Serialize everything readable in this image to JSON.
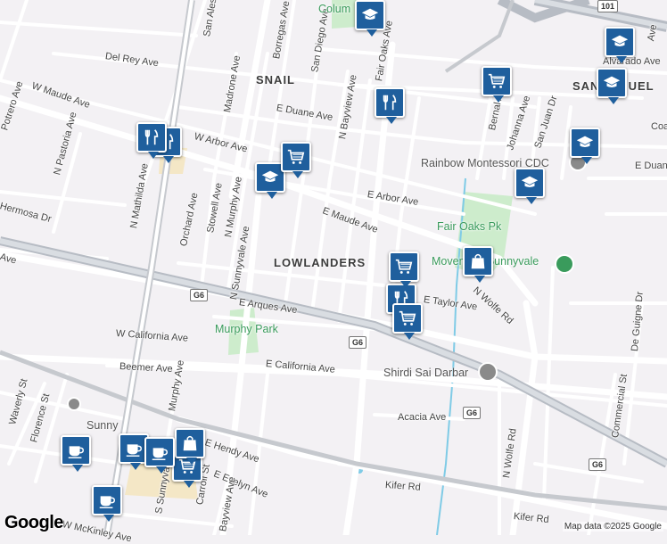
{
  "map": {
    "neighborhoods": [
      "SNAIL",
      "LOWLANDERS",
      "SAN MIGUEL"
    ],
    "streets": [
      "Del Rey Ave",
      "W Maude Ave",
      "Potrero Ave",
      "N Pastoria Ave",
      "N Mathilda Ave",
      "Hermosa Dr",
      "Orchard Ave",
      "Stowell Ave",
      "N Murphy Ave",
      "N Sunnyvale Ave",
      "Madrone Ave",
      "San Aleso Ave",
      "Borregas Ave",
      "W Arbor Ave",
      "E Duane Ave",
      "E Arbor Ave",
      "E Maude Ave",
      "San Diego Ave",
      "N Bayview Ave",
      "Fair Oaks Ave",
      "Bernal Ave",
      "Johanna Ave",
      "San Juan Dr",
      "Alvarado Ave",
      "E Duane Ave",
      "E Arques Ave",
      "E Taylor Ave",
      "N Wolfe Rd",
      "De Guigne Dr",
      "Commercial St",
      "W California Ave",
      "E California Ave",
      "Beemer Ave",
      "Murphy Ave",
      "E Hendy Ave",
      "E Evelyn Ave",
      "Acacia Ave",
      "Kifer Rd",
      "Kifer Rd",
      "Waverly St",
      "Florence St",
      "W McKinley Ave",
      "Carroll St",
      "S Sunnyvale Ave",
      "Bayview Ave",
      "N Wolfe Rd",
      "Ave",
      "Coa",
      "Ave"
    ],
    "shields": [
      "G6",
      "G6",
      "G6",
      "G6",
      "101"
    ],
    "places": [
      {
        "name": "Colum",
        "color": "#3a9b5c"
      },
      {
        "name": "Rainbow Montessori CDC",
        "color": "#555555"
      },
      {
        "name": "Fair Oaks Pk",
        "color": "#3a9b5c"
      },
      {
        "name": "Movement Sunnyvale",
        "color": "#3a9b5c"
      },
      {
        "name": "Murphy Park",
        "color": "#3a9b5c"
      },
      {
        "name": "Shirdi Sai Darbar",
        "color": "#555555"
      },
      {
        "name": "Sunny",
        "color": "#555555"
      }
    ],
    "markers": [
      {
        "type": "school"
      },
      {
        "type": "school"
      },
      {
        "type": "school"
      },
      {
        "type": "school"
      },
      {
        "type": "school"
      },
      {
        "type": "school"
      },
      {
        "type": "restaurant"
      },
      {
        "type": "restaurant"
      },
      {
        "type": "restaurant"
      },
      {
        "type": "restaurant"
      },
      {
        "type": "grocery"
      },
      {
        "type": "grocery"
      },
      {
        "type": "grocery"
      },
      {
        "type": "grocery"
      },
      {
        "type": "grocery"
      },
      {
        "type": "shopping"
      },
      {
        "type": "shopping"
      },
      {
        "type": "cafe"
      },
      {
        "type": "cafe"
      },
      {
        "type": "cafe"
      },
      {
        "type": "cafe"
      }
    ],
    "colors": {
      "marker": "#1f5f9d",
      "park": "#cdeccc",
      "road": "#ffffff",
      "highway": "#b7bcc4",
      "water": "#7fcbe6",
      "background": "#f3f1f4"
    }
  },
  "branding": {
    "logo": "Google",
    "copyright": "Map data ©2025 Google"
  }
}
